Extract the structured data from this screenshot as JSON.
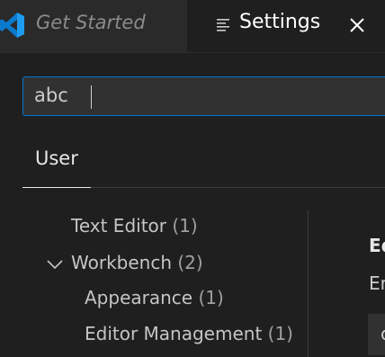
{
  "tabs": [
    {
      "label": "Get Started",
      "icon": "vscode-logo-icon",
      "active": false
    },
    {
      "label": "Settings",
      "icon": "settings-lines-icon",
      "active": true,
      "close_icon": "close-icon"
    }
  ],
  "search": {
    "value": "abc"
  },
  "scope_tabs": [
    {
      "label": "User",
      "active": true
    }
  ],
  "toc": [
    {
      "label": "Text Editor",
      "count": "(1)"
    },
    {
      "label": "Workbench",
      "count": "(2)",
      "expanded": true
    },
    {
      "label": "Appearance",
      "count": "(1)"
    },
    {
      "label": "Editor Management",
      "count": "(1)"
    }
  ],
  "main": {
    "heading": "Ed",
    "description": "En",
    "field_value": "c"
  },
  "colors": {
    "accent": "#0078d4",
    "vscode_blue": "#0a7ace",
    "background": "#1f1f1f"
  }
}
